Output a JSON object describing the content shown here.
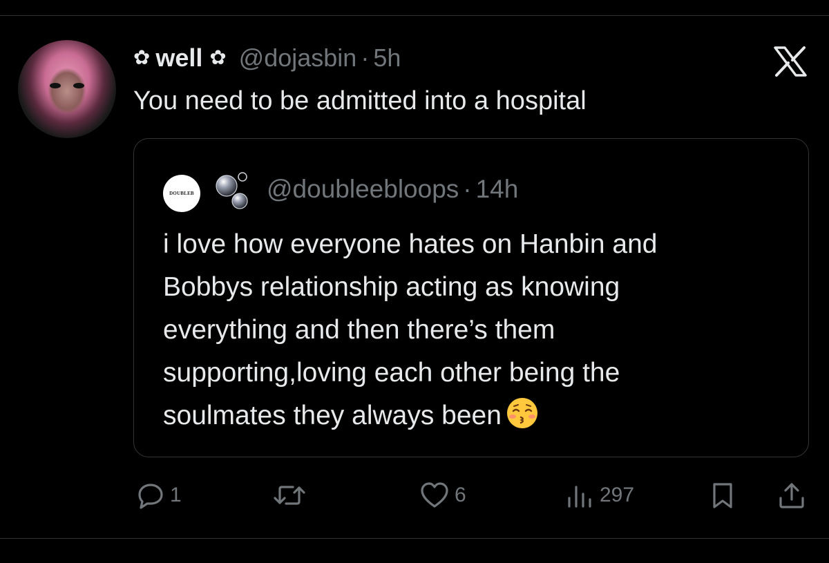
{
  "tweet": {
    "flower_left": "✿",
    "display_name": "well",
    "flower_right": "✿",
    "handle": "@dojasbin",
    "separator": "·",
    "time": "5h",
    "text": "You need to be admitted into a hospital"
  },
  "quote": {
    "avatar_text": "DOUBLEB",
    "handle": "@doubleebloops",
    "separator": "·",
    "time": "14h",
    "text": "i love how everyone hates on Hanbin and\nBobbys relationship acting as knowing\neverything and then there’s them\nsupporting,loving each other being the\nsoulmates they always been",
    "emoji": "kissing-face-with-closed-eyes"
  },
  "actions": {
    "replies": "1",
    "retweets": "",
    "likes": "6",
    "views": "297"
  },
  "colors": {
    "background": "#000000",
    "text": "#e7e9ea",
    "secondary": "#71767b",
    "border": "#333639"
  }
}
